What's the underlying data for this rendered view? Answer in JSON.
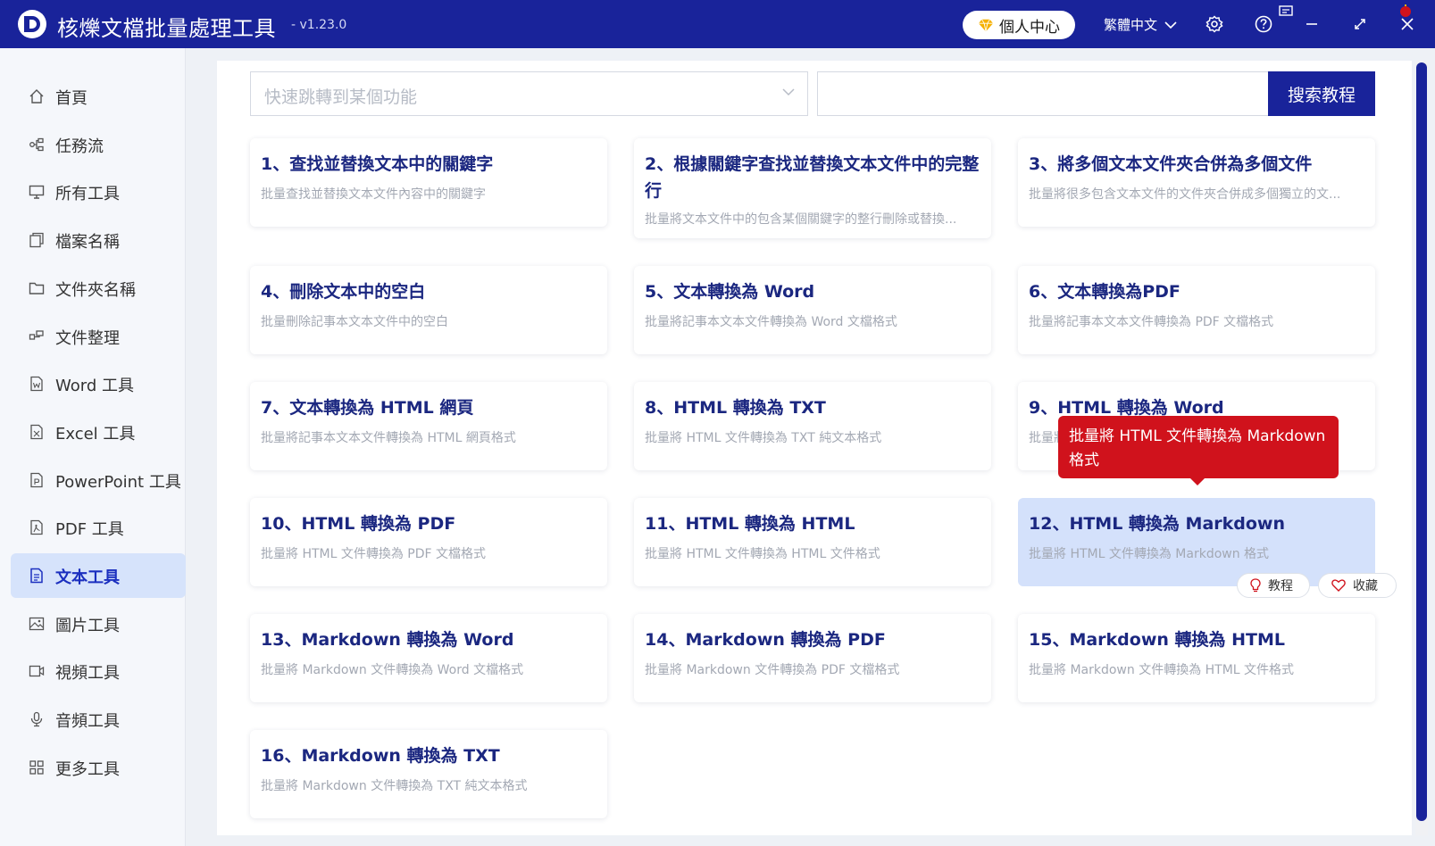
{
  "app": {
    "title": "核爍文檔批量處理工具",
    "version": "- v1.23.0",
    "personal_center": "個人中心",
    "language": "繁體中文",
    "brand_color": "#19239a",
    "accent_red": "#d0121c"
  },
  "sidebar": {
    "items": [
      {
        "label": "首頁",
        "icon": "home-icon"
      },
      {
        "label": "任務流",
        "icon": "workflow-icon"
      },
      {
        "label": "所有工具",
        "icon": "monitor-icon"
      },
      {
        "label": "檔案名稱",
        "icon": "file-copy-icon"
      },
      {
        "label": "文件夾名稱",
        "icon": "folder-icon"
      },
      {
        "label": "文件整理",
        "icon": "organize-icon"
      },
      {
        "label": "Word 工具",
        "icon": "word-file-icon"
      },
      {
        "label": "Excel 工具",
        "icon": "excel-file-icon"
      },
      {
        "label": "PowerPoint 工具",
        "icon": "ppt-file-icon"
      },
      {
        "label": "PDF 工具",
        "icon": "pdf-file-icon"
      },
      {
        "label": "文本工具",
        "icon": "text-file-icon"
      },
      {
        "label": "圖片工具",
        "icon": "image-icon"
      },
      {
        "label": "視頻工具",
        "icon": "video-icon"
      },
      {
        "label": "音頻工具",
        "icon": "microphone-icon"
      },
      {
        "label": "更多工具",
        "icon": "grid-icon"
      }
    ],
    "active_index": 10
  },
  "toolbar": {
    "quick_jump_placeholder": "快速跳轉到某個功能",
    "search_value": "",
    "search_button": "搜索教程"
  },
  "cards": [
    {
      "title": "1、查找並替換文本中的關鍵字",
      "desc": "批量查找並替換文本文件內容中的關鍵字"
    },
    {
      "title": "2、根據關鍵字查找並替換文本文件中的完整行",
      "desc": "批量將文本文件中的包含某個關鍵字的整行刪除或替換..."
    },
    {
      "title": "3、將多個文本文件夾合併為多個文件",
      "desc": "批量將很多包含文本文件的文件夾合併成多個獨立的文..."
    },
    {
      "title": "4、刪除文本中的空白",
      "desc": "批量刪除記事本文本文件中的空白"
    },
    {
      "title": "5、文本轉換為 Word",
      "desc": "批量將記事本文本文件轉換為 Word 文檔格式"
    },
    {
      "title": "6、文本轉換為PDF",
      "desc": "批量將記事本文本文件轉換為 PDF 文檔格式"
    },
    {
      "title": "7、文本轉換為 HTML 網頁",
      "desc": "批量將記事本文本文件轉換為 HTML 網頁格式"
    },
    {
      "title": "8、HTML 轉換為 TXT",
      "desc": "批量將 HTML 文件轉換為 TXT 純文本格式"
    },
    {
      "title": "9、HTML 轉換為 Word",
      "desc": "批量將 HTML 文件轉換為 Word 文檔格式"
    },
    {
      "title": "10、HTML 轉換為 PDF",
      "desc": "批量將 HTML 文件轉換為 PDF 文檔格式"
    },
    {
      "title": "11、HTML 轉換為 HTML",
      "desc": "批量將 HTML 文件轉換為 HTML 文件格式"
    },
    {
      "title": "12、HTML 轉換為 Markdown",
      "desc": "批量將 HTML 文件轉換為 Markdown 格式"
    },
    {
      "title": "13、Markdown 轉換為 Word",
      "desc": "批量將 Markdown 文件轉換為 Word 文檔格式"
    },
    {
      "title": "14、Markdown 轉換為 PDF",
      "desc": "批量將 Markdown 文件轉換為 PDF 文檔格式"
    },
    {
      "title": "15、Markdown 轉換為 HTML",
      "desc": "批量將 Markdown 文件轉換為 HTML 文件格式"
    },
    {
      "title": "16、Markdown 轉換為 TXT",
      "desc": "批量將 Markdown 文件轉換為 TXT 純文本格式"
    }
  ],
  "tooltip": {
    "text": "批量將 HTML 文件轉換為 Markdown 格式"
  },
  "card_actions": {
    "tutorial": "教程",
    "favorite": "收藏"
  }
}
